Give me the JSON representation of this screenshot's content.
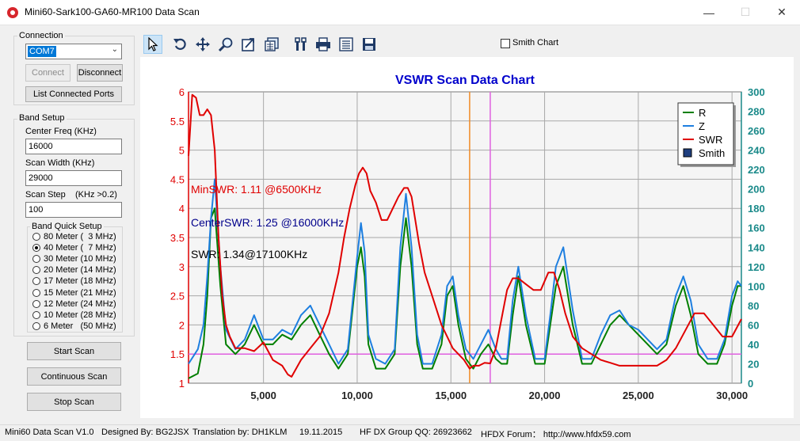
{
  "window": {
    "title": "Mini60-Sark100-GA60-MR100 Data Scan",
    "minimize_glyph": "—",
    "maximize_glyph": "☐",
    "close_glyph": "✕"
  },
  "connection": {
    "group_label": "Connection",
    "port_value": "COM7",
    "connect_label": "Connect",
    "disconnect_label": "Disconnect",
    "list_ports_label": "List Connected Ports"
  },
  "band_setup": {
    "group_label": "Band Setup",
    "center_freq_label": "Center Freq  (KHz)",
    "center_freq_value": "16000",
    "scan_width_label": "Scan Width   (KHz)",
    "scan_width_value": "29000",
    "scan_step_label": "Scan Step",
    "scan_step_hint": "(KHz >0.2)",
    "scan_step_value": "100",
    "quick_setup_label": "Band Quick Setup",
    "bands": [
      {
        "label": "80 Meter (  3 MHz)",
        "selected": false
      },
      {
        "label": "40 Meter (  7 MHz)",
        "selected": true
      },
      {
        "label": "30 Meter (10 MHz)",
        "selected": false
      },
      {
        "label": "20 Meter (14 MHz)",
        "selected": false
      },
      {
        "label": "17 Meter (18 MHz)",
        "selected": false
      },
      {
        "label": "15 Meter (21 MHz)",
        "selected": false
      },
      {
        "label": "12 Meter (24 MHz)",
        "selected": false
      },
      {
        "label": "10 Meter (28 MHz)",
        "selected": false
      },
      {
        "label": "6 Meter   (50 MHz)",
        "selected": false
      }
    ]
  },
  "actions": {
    "start_scan": "Start Scan",
    "continuous_scan": "Continuous Scan",
    "stop_scan": "Stop Scan"
  },
  "toolbar": {
    "tools": [
      "pointer-icon",
      "undo-zoom-icon",
      "pan-icon",
      "zoom-icon",
      "export-icon",
      "copy-data-icon",
      "settings-icon",
      "print-icon",
      "print-preview-icon",
      "save-icon"
    ],
    "smith_chart_label": "Smith Chart",
    "smith_chart_checked": false
  },
  "chart_data": {
    "type": "line",
    "title": "VSWR Scan Data Chart",
    "title_color": "#0000cc",
    "xlim": [
      1000,
      30500
    ],
    "x_ticks": [
      5000,
      10000,
      15000,
      20000,
      25000,
      30000
    ],
    "x_tick_labels": [
      "5,000",
      "10,000",
      "15,000",
      "20,000",
      "25,000",
      "30,000"
    ],
    "y_left_lim": [
      1,
      6
    ],
    "y_left_ticks": [
      "1",
      "1.5",
      "2",
      "2.5",
      "3",
      "3.5",
      "4",
      "4.5",
      "5",
      "5.5",
      "6"
    ],
    "y_right_lim": [
      0,
      300
    ],
    "y_right_ticks": [
      "0",
      "20",
      "40",
      "60",
      "80",
      "100",
      "120",
      "140",
      "160",
      "180",
      "200",
      "220",
      "240",
      "260",
      "280",
      "300"
    ],
    "grid": true,
    "legend_position": "top-right",
    "legend": [
      {
        "name": "R",
        "color": "#007f00"
      },
      {
        "name": "Z",
        "color": "#1e7fe0"
      },
      {
        "name": "SWR",
        "color": "#e00000"
      },
      {
        "name": "Smith",
        "color": "#1f3f7f"
      }
    ],
    "annotations": [
      {
        "text": "MinSWR: 1.11 @6500KHz",
        "color": "#e00000"
      },
      {
        "text": "CenterSWR: 1.25 @16000KHz",
        "color": "#00008b"
      },
      {
        "text": "SWR: 1.34@17100KHz",
        "color": "#000000"
      }
    ],
    "markers": [
      {
        "x": 16000,
        "color": "#f08a24"
      },
      {
        "x": 17100,
        "color": "#e060e0"
      }
    ],
    "reference_line_swr": 1.5,
    "reference_line_color": "#e060e0",
    "series": [
      {
        "name": "SWR",
        "axis": "left",
        "color": "#e00000",
        "x": [
          1000,
          1200,
          1400,
          1600,
          1800,
          2000,
          2200,
          2400,
          2600,
          2800,
          3000,
          3200,
          3500,
          4000,
          4500,
          5000,
          5500,
          6000,
          6300,
          6500,
          7000,
          7500,
          8000,
          8500,
          9000,
          9300,
          9600,
          9900,
          10100,
          10300,
          10500,
          10700,
          11000,
          11300,
          11600,
          11900,
          12200,
          12500,
          12700,
          12900,
          13100,
          13300,
          13600,
          13900,
          14200,
          14500,
          14800,
          15100,
          15400,
          15700,
          16000,
          16200,
          16500,
          16800,
          17100,
          17400,
          17700,
          18000,
          18300,
          18600,
          19000,
          19400,
          19800,
          20200,
          20500,
          20800,
          21100,
          21500,
          22000,
          22500,
          23000,
          23500,
          24000,
          24500,
          25000,
          25500,
          26000,
          26500,
          27000,
          27500,
          28000,
          28500,
          29000,
          29500,
          30000,
          30500
        ],
        "y": [
          4.9,
          5.95,
          5.9,
          5.6,
          5.6,
          5.7,
          5.6,
          5.0,
          3.5,
          2.5,
          2.0,
          1.8,
          1.6,
          1.6,
          1.55,
          1.7,
          1.4,
          1.3,
          1.15,
          1.11,
          1.4,
          1.6,
          1.8,
          2.2,
          2.9,
          3.5,
          4.0,
          4.4,
          4.6,
          4.7,
          4.6,
          4.3,
          4.1,
          3.8,
          3.8,
          4.0,
          4.2,
          4.35,
          4.35,
          4.2,
          3.8,
          3.4,
          2.9,
          2.6,
          2.3,
          2.0,
          1.8,
          1.6,
          1.5,
          1.4,
          1.25,
          1.3,
          1.3,
          1.35,
          1.34,
          1.6,
          2.1,
          2.6,
          2.8,
          2.8,
          2.7,
          2.6,
          2.6,
          2.9,
          2.9,
          2.6,
          2.2,
          1.8,
          1.6,
          1.5,
          1.4,
          1.35,
          1.3,
          1.3,
          1.3,
          1.3,
          1.3,
          1.4,
          1.6,
          1.9,
          2.2,
          2.2,
          2.0,
          1.8,
          1.8,
          2.1
        ]
      },
      {
        "name": "R",
        "axis": "right",
        "color": "#007f00",
        "x": [
          1000,
          1500,
          1800,
          2000,
          2200,
          2400,
          2700,
          3000,
          3500,
          4000,
          4500,
          5000,
          5500,
          6000,
          6500,
          7000,
          7500,
          8000,
          8500,
          9000,
          9500,
          10000,
          10200,
          10400,
          10600,
          11000,
          11500,
          12000,
          12300,
          12600,
          12900,
          13200,
          13500,
          14000,
          14500,
          14800,
          15100,
          15400,
          15800,
          16200,
          16600,
          17000,
          17400,
          17700,
          18000,
          18300,
          18600,
          19000,
          19500,
          20000,
          20300,
          20600,
          21000,
          21500,
          22000,
          22500,
          23000,
          23500,
          24000,
          24500,
          25000,
          25500,
          26000,
          26500,
          27000,
          27400,
          27800,
          28200,
          28700,
          29200,
          29600,
          30000,
          30300,
          30500
        ],
        "y": [
          5,
          10,
          40,
          90,
          170,
          180,
          100,
          40,
          30,
          40,
          60,
          40,
          40,
          50,
          45,
          60,
          70,
          50,
          30,
          15,
          30,
          120,
          140,
          110,
          40,
          15,
          15,
          30,
          120,
          170,
          120,
          40,
          15,
          15,
          40,
          90,
          100,
          60,
          25,
          15,
          30,
          40,
          25,
          20,
          20,
          70,
          110,
          60,
          20,
          20,
          60,
          100,
          120,
          60,
          20,
          20,
          40,
          60,
          70,
          60,
          50,
          40,
          30,
          40,
          80,
          100,
          70,
          30,
          20,
          20,
          40,
          80,
          100,
          100
        ]
      },
      {
        "name": "Z",
        "axis": "right",
        "color": "#1e7fe0",
        "x": [
          1000,
          1500,
          1800,
          2000,
          2200,
          2400,
          2700,
          3000,
          3500,
          4000,
          4500,
          5000,
          5500,
          6000,
          6500,
          7000,
          7500,
          8000,
          8500,
          9000,
          9500,
          10000,
          10200,
          10400,
          10600,
          11000,
          11500,
          12000,
          12300,
          12600,
          12900,
          13200,
          13500,
          14000,
          14500,
          14800,
          15100,
          15400,
          15800,
          16200,
          16600,
          17000,
          17400,
          17700,
          18000,
          18300,
          18600,
          19000,
          19500,
          20000,
          20300,
          20600,
          21000,
          21500,
          22000,
          22500,
          23000,
          23500,
          24000,
          24500,
          25000,
          25500,
          26000,
          26500,
          27000,
          27400,
          27800,
          28200,
          28700,
          29200,
          29600,
          30000,
          30300,
          30500
        ],
        "y": [
          20,
          35,
          60,
          110,
          170,
          210,
          120,
          55,
          35,
          45,
          70,
          45,
          45,
          55,
          50,
          70,
          80,
          60,
          40,
          20,
          35,
          130,
          165,
          135,
          50,
          25,
          20,
          35,
          140,
          195,
          140,
          50,
          20,
          20,
          50,
          100,
          110,
          70,
          35,
          25,
          40,
          55,
          35,
          25,
          25,
          85,
          120,
          70,
          25,
          25,
          70,
          120,
          140,
          75,
          25,
          25,
          50,
          70,
          75,
          60,
          55,
          45,
          35,
          45,
          90,
          110,
          85,
          40,
          25,
          25,
          45,
          90,
          105,
          100
        ]
      }
    ]
  },
  "status": {
    "version": "Mini60 Data Scan V1.0",
    "designed_by": "Designed By: BG2JSX",
    "translation": "Translation by: DH1KLM",
    "date": "19.11.2015",
    "qq": "HF DX Group QQ: 26923662",
    "forum": "HFDX Forum：  http://www.hfdx59.com"
  }
}
